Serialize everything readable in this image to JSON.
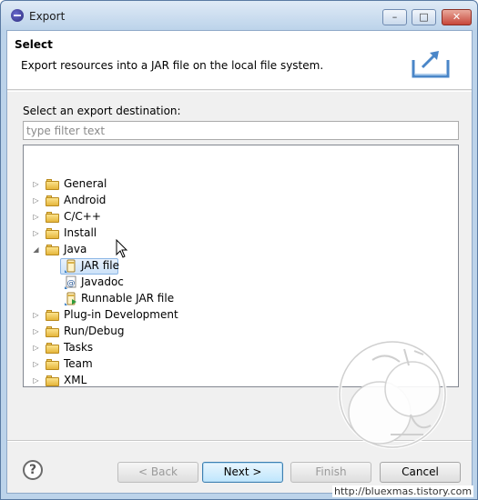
{
  "window": {
    "title": "Export"
  },
  "header": {
    "title": "Select",
    "description": "Export resources into a JAR file on the local file system."
  },
  "destination": {
    "prompt": "Select an export destination:",
    "filter_placeholder": "type filter text",
    "filter_value": ""
  },
  "tree": [
    {
      "label": "General",
      "type": "folder",
      "expanded": false
    },
    {
      "label": "Android",
      "type": "folder",
      "expanded": false
    },
    {
      "label": "C/C++",
      "type": "folder",
      "expanded": false
    },
    {
      "label": "Install",
      "type": "folder",
      "expanded": false
    },
    {
      "label": "Java",
      "type": "folder",
      "expanded": true
    },
    {
      "label": "JAR file",
      "type": "jar",
      "selected": true
    },
    {
      "label": "Javadoc",
      "type": "javadoc"
    },
    {
      "label": "Runnable JAR file",
      "type": "runnable-jar"
    },
    {
      "label": "Plug-in Development",
      "type": "folder",
      "expanded": false
    },
    {
      "label": "Run/Debug",
      "type": "folder",
      "expanded": false
    },
    {
      "label": "Tasks",
      "type": "folder",
      "expanded": false
    },
    {
      "label": "Team",
      "type": "folder",
      "expanded": false
    },
    {
      "label": "XML",
      "type": "folder",
      "expanded": false
    }
  ],
  "buttons": {
    "back": "< Back",
    "next": "Next >",
    "finish": "Finish",
    "cancel": "Cancel"
  },
  "watermark_url": "http://bluexmas.tistory.com"
}
